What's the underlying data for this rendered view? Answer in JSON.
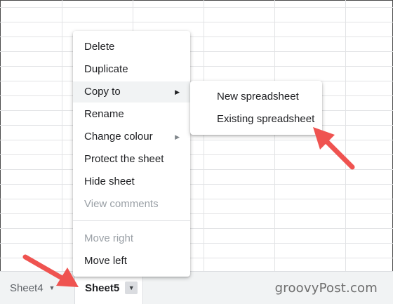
{
  "context_menu": {
    "items": [
      {
        "label": "Delete",
        "disabled": false,
        "has_submenu": false
      },
      {
        "label": "Duplicate",
        "disabled": false,
        "has_submenu": false
      },
      {
        "label": "Copy to",
        "disabled": false,
        "has_submenu": true,
        "highlighted": true
      },
      {
        "label": "Rename",
        "disabled": false,
        "has_submenu": false
      },
      {
        "label": "Change colour",
        "disabled": false,
        "has_submenu": true
      },
      {
        "label": "Protect the sheet",
        "disabled": false,
        "has_submenu": false
      },
      {
        "label": "Hide sheet",
        "disabled": false,
        "has_submenu": false
      },
      {
        "label": "View comments",
        "disabled": true,
        "has_submenu": false
      },
      {
        "label": "Move right",
        "disabled": true,
        "has_submenu": false
      },
      {
        "label": "Move left",
        "disabled": false,
        "has_submenu": false
      }
    ]
  },
  "copy_to_submenu": {
    "items": [
      {
        "label": "New spreadsheet"
      },
      {
        "label": "Existing spreadsheet"
      }
    ]
  },
  "sheet_tabs": [
    {
      "label": "Sheet4",
      "active": false
    },
    {
      "label": "Sheet5",
      "active": true
    }
  ],
  "watermark": "groovyPost.com",
  "colors": {
    "annotation_arrow": "#ef5350",
    "menu_highlight": "#f1f3f4",
    "disabled_text": "#9aa0a6",
    "sheetbar_bg": "#f1f3f4"
  },
  "icons": {
    "submenu_arrow": "triangle-right-icon",
    "tab_dropdown": "triangle-down-icon"
  }
}
